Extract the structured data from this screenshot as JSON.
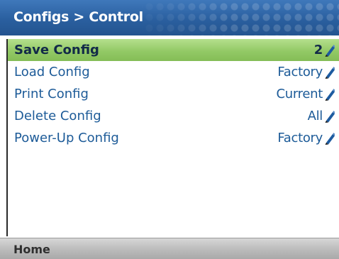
{
  "header": {
    "title": "Configs > Control"
  },
  "menu": {
    "items": [
      {
        "label": "Save Config",
        "value": "2",
        "selected": true,
        "icon": "pencil-icon"
      },
      {
        "label": "Load Config",
        "value": "Factory",
        "selected": false,
        "icon": "pencil-icon"
      },
      {
        "label": "Print Config",
        "value": "Current",
        "selected": false,
        "icon": "pencil-icon"
      },
      {
        "label": "Delete Config",
        "value": "All",
        "selected": false,
        "icon": "pencil-icon"
      },
      {
        "label": "Power-Up Config",
        "value": "Factory",
        "selected": false,
        "icon": "pencil-icon"
      }
    ]
  },
  "footer": {
    "home_label": "Home"
  },
  "colors": {
    "header_blue": "#2a5f9f",
    "selected_green": "#93c966",
    "item_text_blue": "#1d5b98",
    "footer_gray": "#bdbdbd"
  }
}
